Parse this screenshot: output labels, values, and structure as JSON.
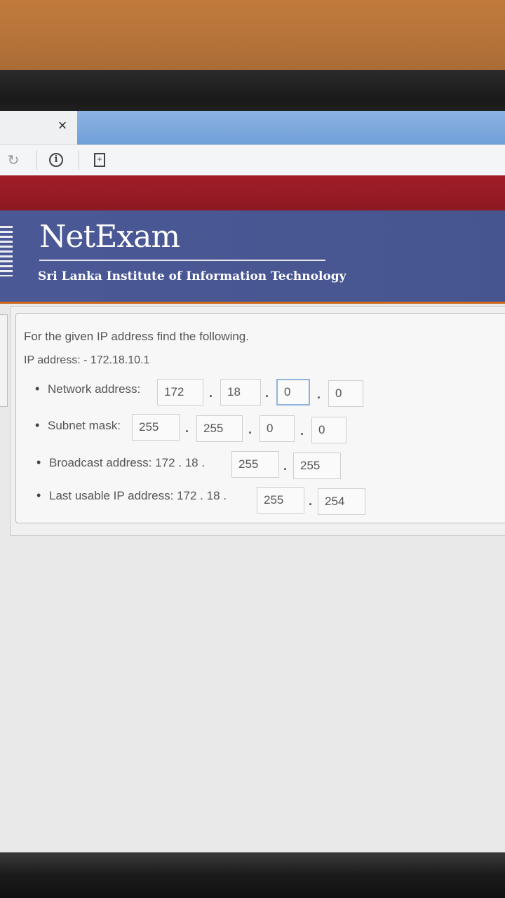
{
  "browser": {
    "close_glyph": "×",
    "reload_glyph": "↻"
  },
  "banner": {
    "brand": "NetExam",
    "subtitle": "Sri Lanka Institute of Information Technology"
  },
  "question": {
    "prompt": "For the given IP address find the following.",
    "ip_line": "IP address: - 172.18.10.1",
    "network": {
      "label": "Network address:",
      "octets": [
        "172",
        "18",
        "0",
        "0"
      ]
    },
    "subnet": {
      "label": "Subnet mask:",
      "octets": [
        "255",
        "255",
        "0",
        "0"
      ]
    },
    "broadcast": {
      "label": "Broadcast address: 172 . 18 .",
      "octets": [
        "255",
        "255"
      ]
    },
    "last_usable": {
      "label": "Last usable IP address: 172 . 18 .",
      "octets": [
        "255",
        "254"
      ]
    }
  }
}
